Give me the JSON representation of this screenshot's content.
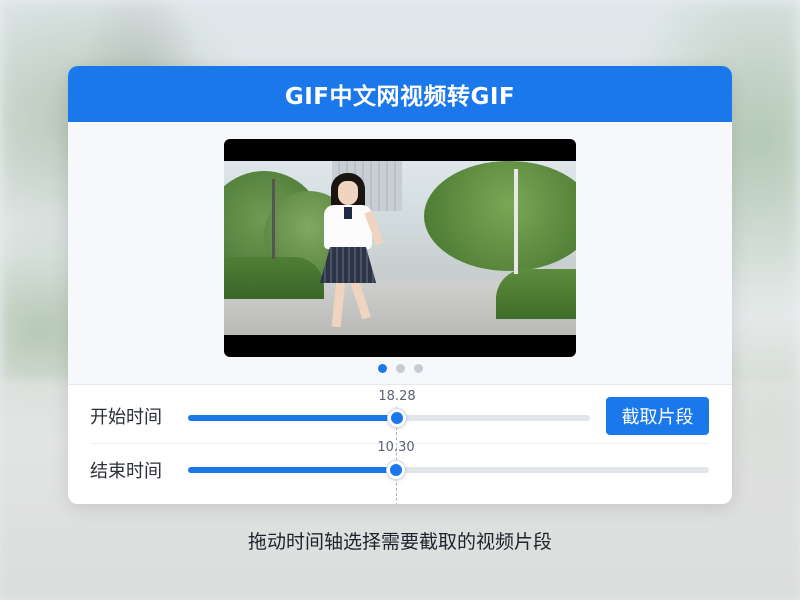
{
  "app": {
    "title": "GIF中文网视频转GIF"
  },
  "carousel": {
    "count": 3,
    "active_index": 0
  },
  "timeline": {
    "start": {
      "label": "开始时间",
      "value": "18.28",
      "fraction": 0.52
    },
    "end": {
      "label": "结束时间",
      "value": "10.30",
      "fraction": 0.4
    },
    "cut_button_label": "截取片段"
  },
  "caption": "拖动时间轴选择需要截取的视频片段",
  "colors": {
    "accent": "#1a78ea"
  }
}
